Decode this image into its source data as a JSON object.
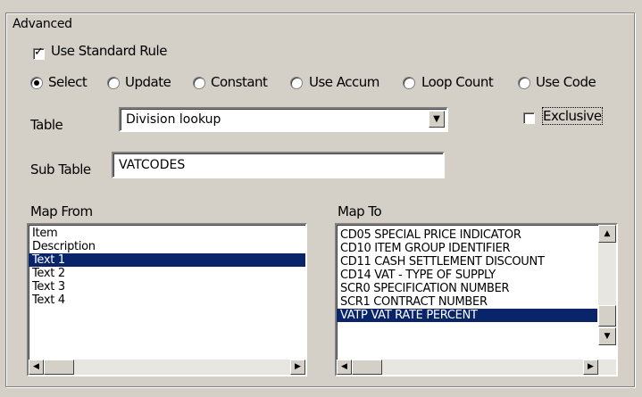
{
  "group": {
    "title": "Advanced"
  },
  "use_standard_rule": {
    "label": "Use Standard Rule",
    "checked": true
  },
  "radio_options": [
    {
      "label": "Select",
      "selected": true
    },
    {
      "label": "Update",
      "selected": false
    },
    {
      "label": "Constant",
      "selected": false
    },
    {
      "label": "Use Accum",
      "selected": false
    },
    {
      "label": "Loop Count",
      "selected": false
    },
    {
      "label": "Use Code",
      "selected": false
    }
  ],
  "table": {
    "label": "Table",
    "value": "Division lookup"
  },
  "exclusive": {
    "label": "Exclusive",
    "checked": false
  },
  "sub_table": {
    "label": "Sub Table",
    "value": "VATCODES"
  },
  "map_from": {
    "label": "Map From",
    "items": [
      "Item",
      "Description",
      "Text 1",
      "Text 2",
      "Text 3",
      "Text 4"
    ],
    "selected_index": 2
  },
  "map_to": {
    "label": "Map To",
    "items": [
      "CD05 SPECIAL PRICE INDICATOR",
      "CD10 ITEM GROUP IDENTIFIER",
      "CD11 CASH SETTLEMENT DISCOUNT",
      "CD14 VAT - TYPE OF SUPPLY",
      "SCR0 SPECIFICATION NUMBER",
      "SCR1 CONTRACT NUMBER",
      "VATP VAT RATE PERCENT"
    ],
    "selected_index": 6
  },
  "icons": {
    "checkmark": "check-icon",
    "dropdown": "chevron-down-icon",
    "scroll_up": "arrow-up-icon",
    "scroll_down": "arrow-down-icon",
    "scroll_left": "arrow-left-icon",
    "scroll_right": "arrow-right-icon"
  },
  "colors": {
    "selection": "#0a246a",
    "face": "#d4d0c8"
  }
}
